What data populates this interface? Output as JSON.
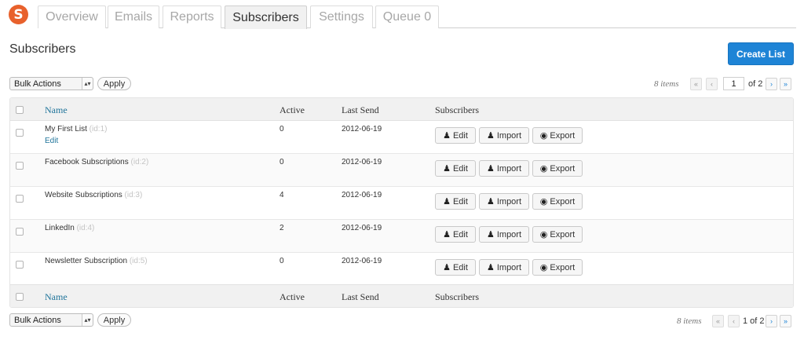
{
  "tabs": [
    {
      "label": "Overview"
    },
    {
      "label": "Emails"
    },
    {
      "label": "Reports"
    },
    {
      "label": "Subscribers"
    },
    {
      "label": "Settings"
    },
    {
      "label": "Queue 0"
    }
  ],
  "logo_letter": "S",
  "page_title": "Subscribers",
  "create_button": "Create List",
  "bulk": {
    "selected": "Bulk Actions",
    "apply": "Apply"
  },
  "pagination_top": {
    "items": "8 items",
    "first": "«",
    "prev": "‹",
    "page_value": "1",
    "of": "of 2",
    "next": "›",
    "last": "»"
  },
  "pagination_bottom": {
    "items": "8 items",
    "first": "«",
    "prev": "‹",
    "current": "1 of 2",
    "next": "›",
    "last": "»"
  },
  "columns": {
    "name": "Name",
    "active": "Active",
    "last_send": "Last Send",
    "subscribers": "Subscribers"
  },
  "actions": {
    "edit": "Edit",
    "import": "Import",
    "export": "Export"
  },
  "row_edit_link": "Edit",
  "rows": [
    {
      "name": "My First List",
      "id": "(id:1)",
      "active": "0",
      "last_send": "2012-06-19"
    },
    {
      "name": "Facebook Subscriptions",
      "id": "(id:2)",
      "active": "0",
      "last_send": "2012-06-19"
    },
    {
      "name": "Website Subscriptions",
      "id": "(id:3)",
      "active": "4",
      "last_send": "2012-06-19"
    },
    {
      "name": "LinkedIn",
      "id": "(id:4)",
      "active": "2",
      "last_send": "2012-06-19"
    },
    {
      "name": "Newsletter Subscription",
      "id": "(id:5)",
      "active": "0",
      "last_send": "2012-06-19"
    }
  ],
  "colors": {
    "accent": "#1e84d6",
    "logo": "#e8612c",
    "link": "#21759b"
  },
  "icons": {
    "logo": "sendpress-logo-icon",
    "user": "user-icon",
    "export": "export-icon",
    "select": "select-arrows-icon"
  }
}
